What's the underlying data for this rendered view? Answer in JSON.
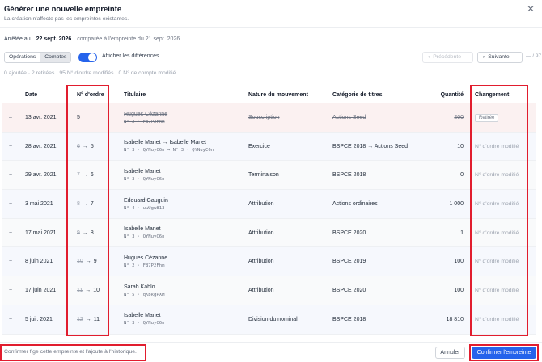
{
  "header": {
    "title": "Générer une nouvelle empreinte",
    "subtitle": "La création n'affecte pas les empreintes existantes."
  },
  "dateline": {
    "label": "Arrêtée au",
    "date": "22 sept. 2026",
    "compared": "comparée à l'empreinte du 21 sept. 2026"
  },
  "toolbar": {
    "tabs": [
      "Opérations",
      "Comptes"
    ],
    "toggle_label": "Afficher les différences",
    "toggle_on": true,
    "prev_label": "Précédente",
    "next_label": "Suivante",
    "count": "— / 97"
  },
  "summary": "0 ajoutée · 2 retirées · 95 N° d'ordre modifiés · 0 N° de compte modifié",
  "table": {
    "columns": [
      "Date",
      "N° d'ordre",
      "Titulaire",
      "Nature du mouvement",
      "Catégorie de titres",
      "Quantité",
      "Changement"
    ],
    "rows": [
      {
        "mark": "–",
        "date": "13 avr. 2021",
        "ord_old": "5",
        "ord_new": "",
        "holder": "Hugues Cézanne",
        "holder_sub": "N° 2 · F87P2Fhm",
        "nature": "Souscription",
        "category": "Actions Seed",
        "qty": "200",
        "change": "Retirée"
      },
      {
        "mark": "~",
        "date": "28 avr. 2021",
        "ord_old": "6",
        "ord_new": "5",
        "holder": "Isabelle Manet → Isabelle Manet",
        "holder_sub": "N° 3 · QYNuyC6n → N° 3 · QYNuyC6n",
        "nature": "Exercice",
        "category": "BSPCE 2018 → Actions Seed",
        "qty": "10",
        "change": "N° d'ordre modifié"
      },
      {
        "mark": "~",
        "date": "29 avr. 2021",
        "ord_old": "7",
        "ord_new": "6",
        "holder": "Isabelle Manet",
        "holder_sub": "N° 3 · QYNuyC6n",
        "nature": "Terminaison",
        "category": "BSPCE 2018",
        "qty": "0",
        "change": "N° d'ordre modifié"
      },
      {
        "mark": "~",
        "date": "3 mai 2021",
        "ord_old": "8",
        "ord_new": "7",
        "holder": "Edouard Gauguin",
        "holder_sub": "N° 4 · uwUgw813",
        "nature": "Attribution",
        "category": "Actions ordinaires",
        "qty": "1 000",
        "change": "N° d'ordre modifié"
      },
      {
        "mark": "~",
        "date": "17 mai 2021",
        "ord_old": "9",
        "ord_new": "8",
        "holder": "Isabelle Manet",
        "holder_sub": "N° 3 · QYNuyC6n",
        "nature": "Attribution",
        "category": "BSPCE 2020",
        "qty": "1",
        "change": "N° d'ordre modifié"
      },
      {
        "mark": "~",
        "date": "8 juin 2021",
        "ord_old": "10",
        "ord_new": "9",
        "holder": "Hugues Cézanne",
        "holder_sub": "N° 2 · F87P2Fhm",
        "nature": "Attribution",
        "category": "BSPCE 2019",
        "qty": "100",
        "change": "N° d'ordre modifié"
      },
      {
        "mark": "~",
        "date": "17 juin 2021",
        "ord_old": "11",
        "ord_new": "10",
        "holder": "Sarah Kahlo",
        "holder_sub": "N° 5 · qKbkgPXM",
        "nature": "Attribution",
        "category": "BSPCE 2020",
        "qty": "100",
        "change": "N° d'ordre modifié"
      },
      {
        "mark": "~",
        "date": "5 juil. 2021",
        "ord_old": "12",
        "ord_new": "11",
        "holder": "Isabelle Manet",
        "holder_sub": "N° 3 · QYNuyC6n",
        "nature": "Division du nominal",
        "category": "BSPCE 2018",
        "qty": "18 810",
        "change": "N° d'ordre modifié"
      }
    ]
  },
  "footer": {
    "note": "Confirmer fige cette empreinte et l'ajoute à l'historique.",
    "cancel_label": "Annuler",
    "confirm_label": "Confirmer l'empreinte"
  },
  "colors": {
    "accent": "#2563eb",
    "highlight": "#e11d2e",
    "removed_row": "#fbf1f1"
  }
}
